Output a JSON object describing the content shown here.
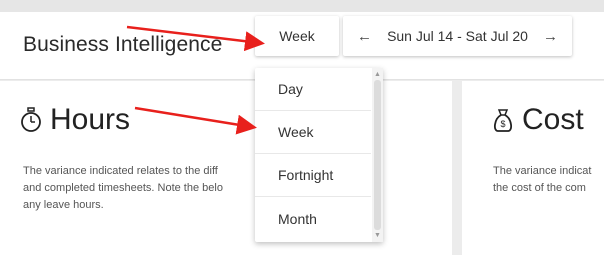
{
  "header": {
    "title": "Business Intelligence",
    "period_selected": "Week",
    "date_range": "Sun Jul 14 - Sat Jul 20"
  },
  "period_dropdown": {
    "options": [
      "Day",
      "Week",
      "Fortnight",
      "Month"
    ]
  },
  "cards": {
    "hours": {
      "title": "Hours",
      "icon": "stopwatch-icon",
      "description_lines": [
        "The variance indicated relates to the diff                              rs",
        "and completed timesheets. Note the belo                              de",
        "any leave hours."
      ]
    },
    "cost": {
      "title": "Cost",
      "icon": "money-bag-icon",
      "description_lines": [
        "The variance indicat",
        "the cost of the com"
      ]
    }
  },
  "annotation_color": "#e8201c"
}
